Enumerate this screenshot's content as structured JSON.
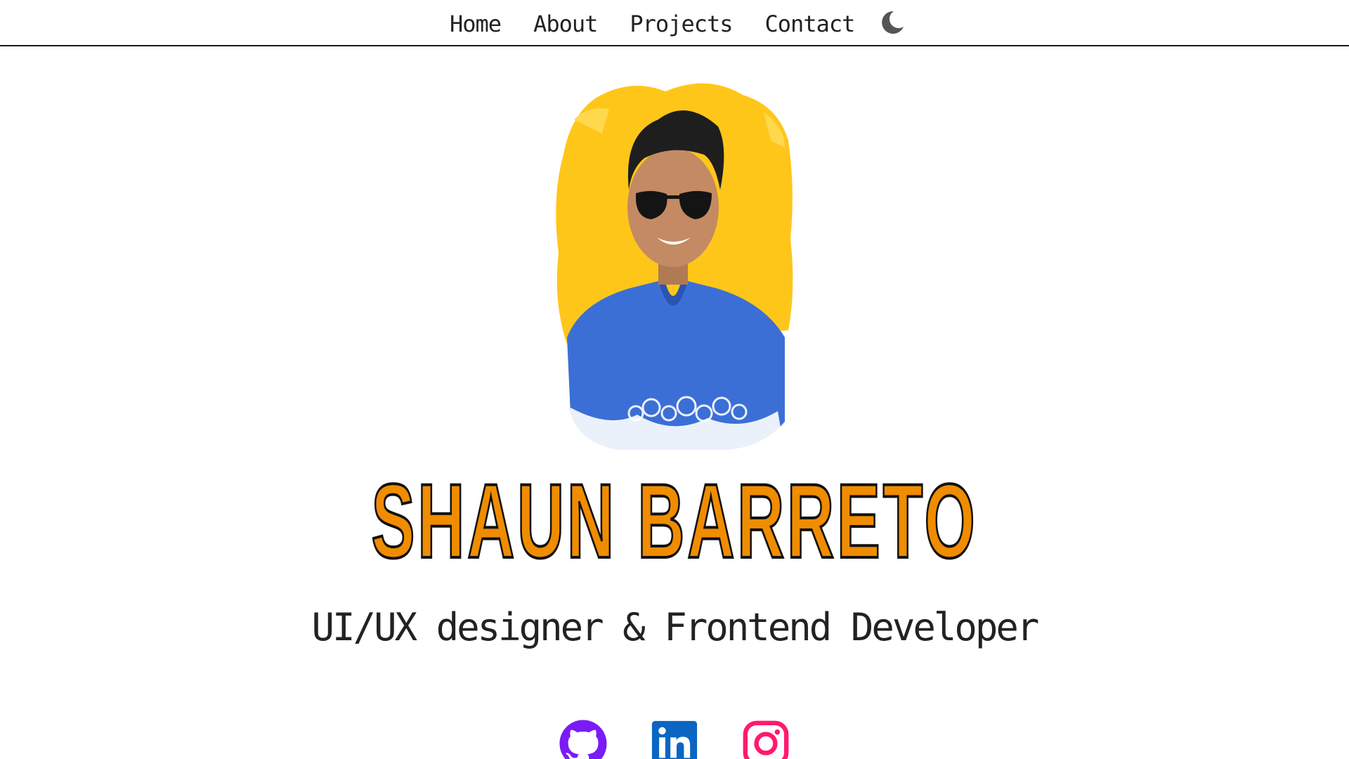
{
  "nav": {
    "links": [
      {
        "label": "Home"
      },
      {
        "label": "About"
      },
      {
        "label": "Projects"
      },
      {
        "label": "Contact"
      }
    ],
    "theme_toggle_icon": "moon-icon"
  },
  "hero": {
    "name": "SHAUN BARRETO",
    "tagline": "UI/UX designer & Frontend Developer",
    "portrait_icon": "profile-photo"
  },
  "socials": [
    {
      "icon": "github-icon",
      "color": "#7a1cf5"
    },
    {
      "icon": "linkedin-icon",
      "color": "#0a66c2"
    },
    {
      "icon": "instagram-icon",
      "color": "#ff1a6e"
    }
  ],
  "colors": {
    "name_fill": "#f08c00",
    "name_stroke": "#111111",
    "portrait_bg": "#ffc61a",
    "shirt": "#3b6fd6"
  }
}
